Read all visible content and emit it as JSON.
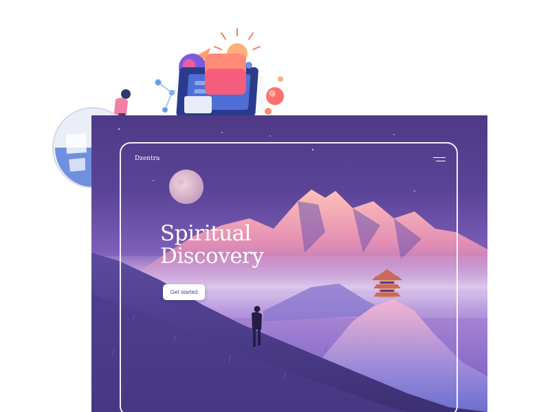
{
  "site": {
    "logo": "Dzentra",
    "menu_icon": "hamburger-menu-icon"
  },
  "hero": {
    "title_line1": "Spiritual",
    "title_line2": "Discovery",
    "cta_label": "Get started"
  },
  "colors": {
    "sky_top": "#4e3a86",
    "mountain_peak": "#f2a6b5",
    "cta_text": "#4e3f99",
    "frame": "#ffffff"
  },
  "decorations": {
    "icons": [
      "lightbulb-icon",
      "laptop-icon",
      "globe-icon",
      "person-icon",
      "rocket-icon",
      "moon-icon",
      "pagoda-icon",
      "hiker-icon"
    ]
  }
}
